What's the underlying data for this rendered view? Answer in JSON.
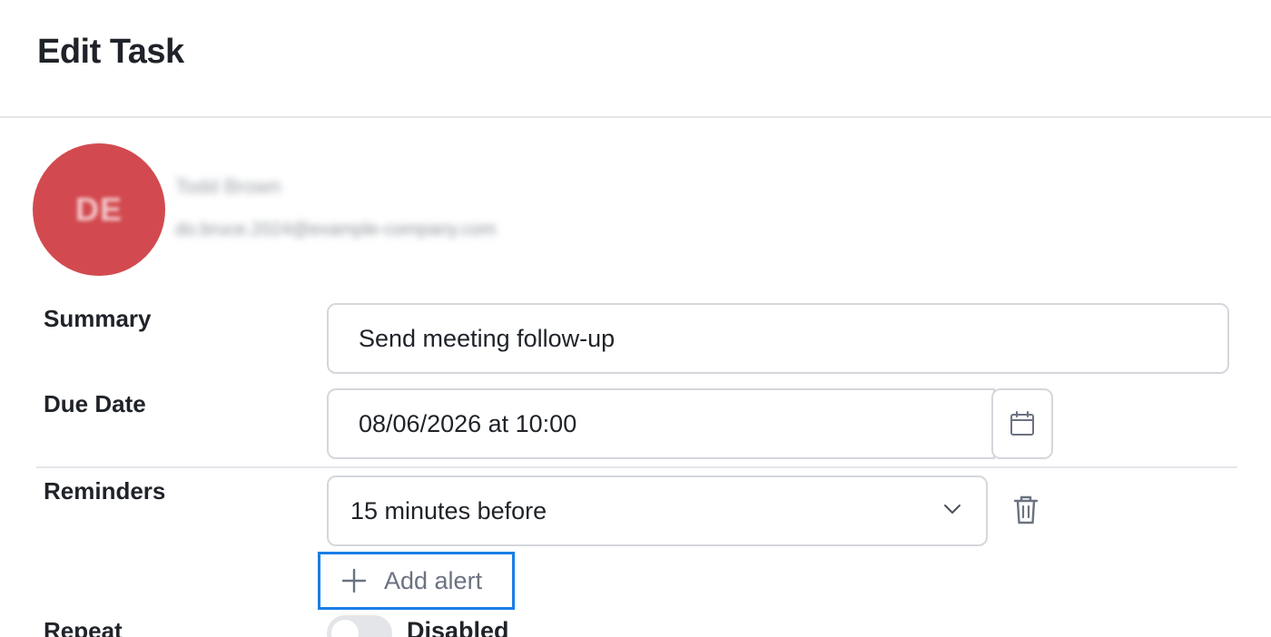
{
  "header": {
    "title": "Edit Task"
  },
  "user": {
    "initials": "DE",
    "name": "Todd Brown",
    "email": "do.bruce.2024@example-company.com",
    "avatar_color": "#d24a4f"
  },
  "form": {
    "summary": {
      "label": "Summary",
      "value": "Send meeting follow-up"
    },
    "due_date": {
      "label": "Due Date",
      "value": "08/06/2026 at 10:00",
      "button_icon": "calendar-icon"
    },
    "reminders": {
      "label": "Reminders",
      "selected": "15 minutes before",
      "delete_icon": "trash-icon",
      "add_label": "Add alert"
    },
    "repeat": {
      "label": "Repeat",
      "toggle_state": "off",
      "toggle_label": "Disabled"
    }
  },
  "colors": {
    "accent_focus": "#1a7ee6",
    "border": "#d4d7dc",
    "text": "#1f2329",
    "muted_text": "#6b7280"
  }
}
